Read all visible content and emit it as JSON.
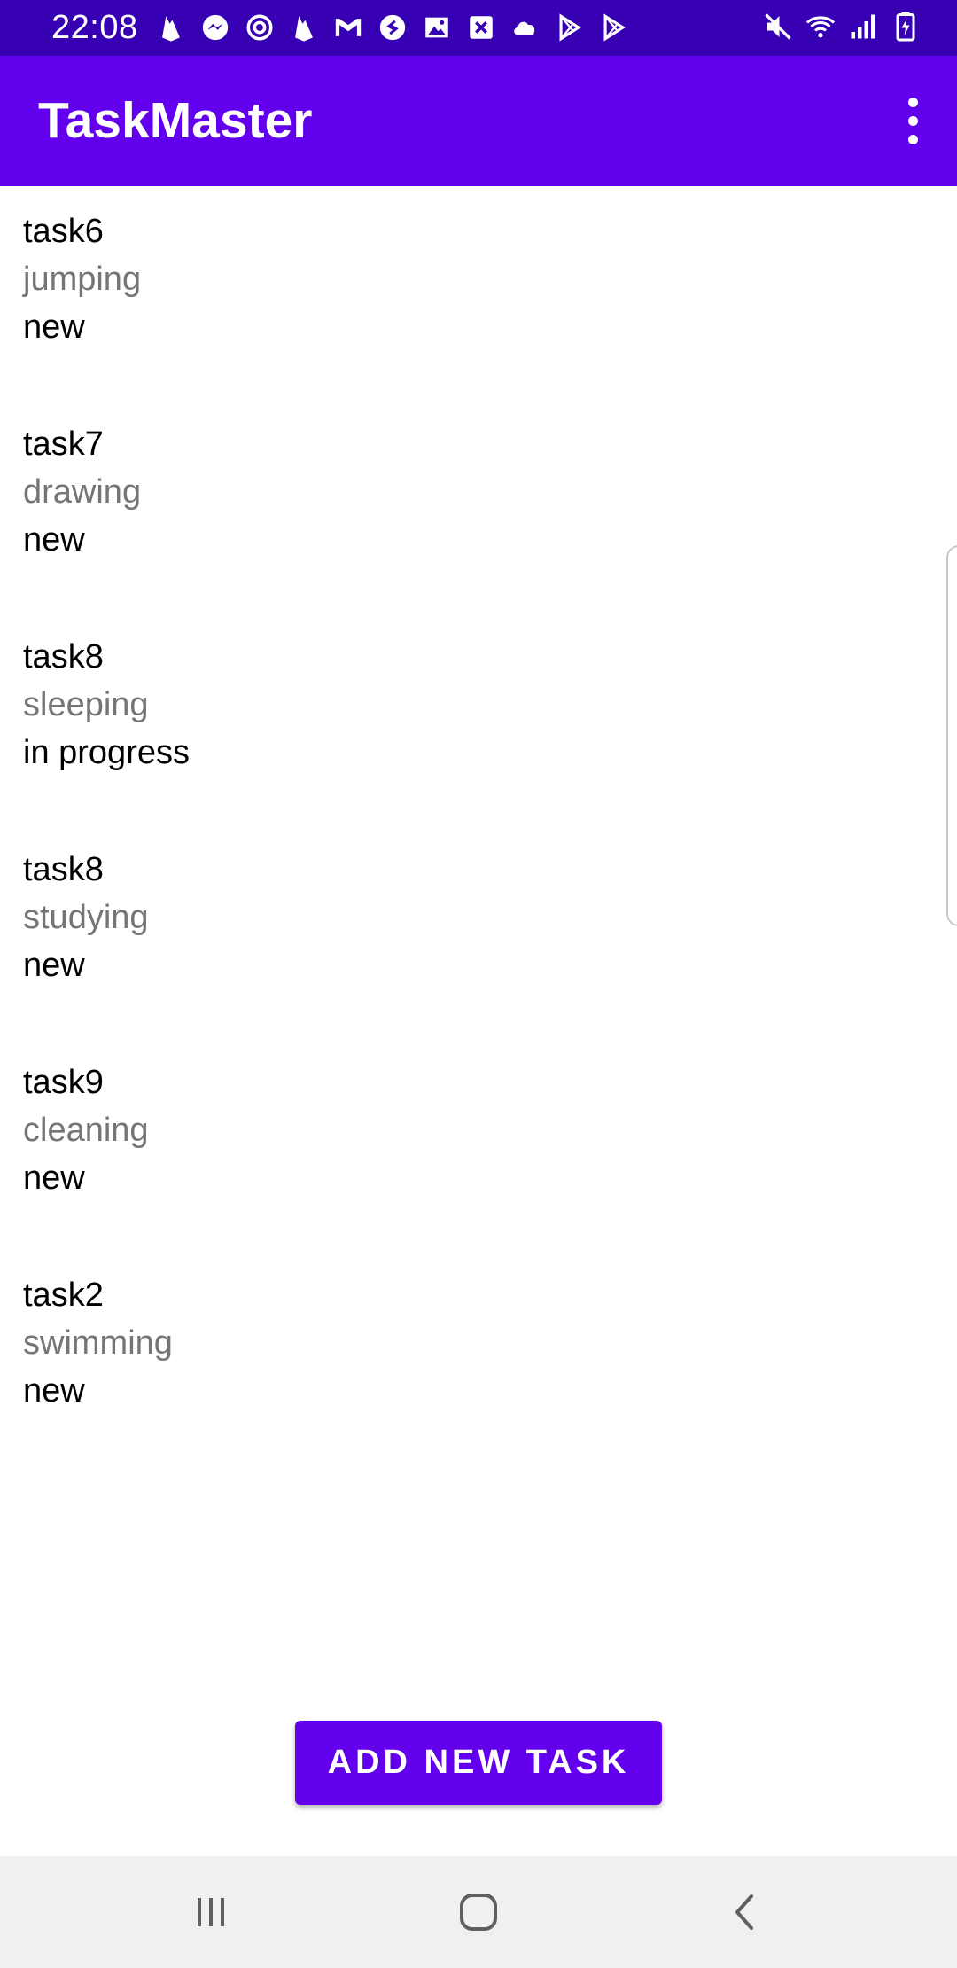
{
  "status_bar": {
    "time": "22:08",
    "notification_icons": [
      "firebase-icon",
      "messenger-icon",
      "sync-icon",
      "firebase-icon",
      "gmail-icon",
      "shazam-icon",
      "gallery-icon",
      "excel-icon",
      "cloud-icon",
      "play-store-icon",
      "play-store-icon"
    ],
    "system_icons": [
      "mute-icon",
      "wifi-icon",
      "signal-icon",
      "battery-charging-icon"
    ]
  },
  "app_bar": {
    "title": "TaskMaster",
    "overflow_icon": "more-vert-icon"
  },
  "tasks": [
    {
      "title": "task6",
      "body": "jumping",
      "state": "new"
    },
    {
      "title": "task7",
      "body": "drawing",
      "state": "new"
    },
    {
      "title": "task8",
      "body": "sleeping",
      "state": "in progress"
    },
    {
      "title": "task8",
      "body": "studying",
      "state": "new"
    },
    {
      "title": "task9",
      "body": "cleaning",
      "state": "new"
    },
    {
      "title": "task2",
      "body": "swimming",
      "state": "new"
    }
  ],
  "add_button": {
    "label": "ADD NEW TASK"
  },
  "nav_bar": {
    "icons": [
      "recent-apps-icon",
      "home-icon",
      "back-icon"
    ]
  },
  "colors": {
    "status_bar": "#3700b3",
    "app_bar": "#6200ee",
    "button": "#6200ee",
    "secondary_text": "#757575",
    "nav_bar": "#f0f0f0"
  }
}
